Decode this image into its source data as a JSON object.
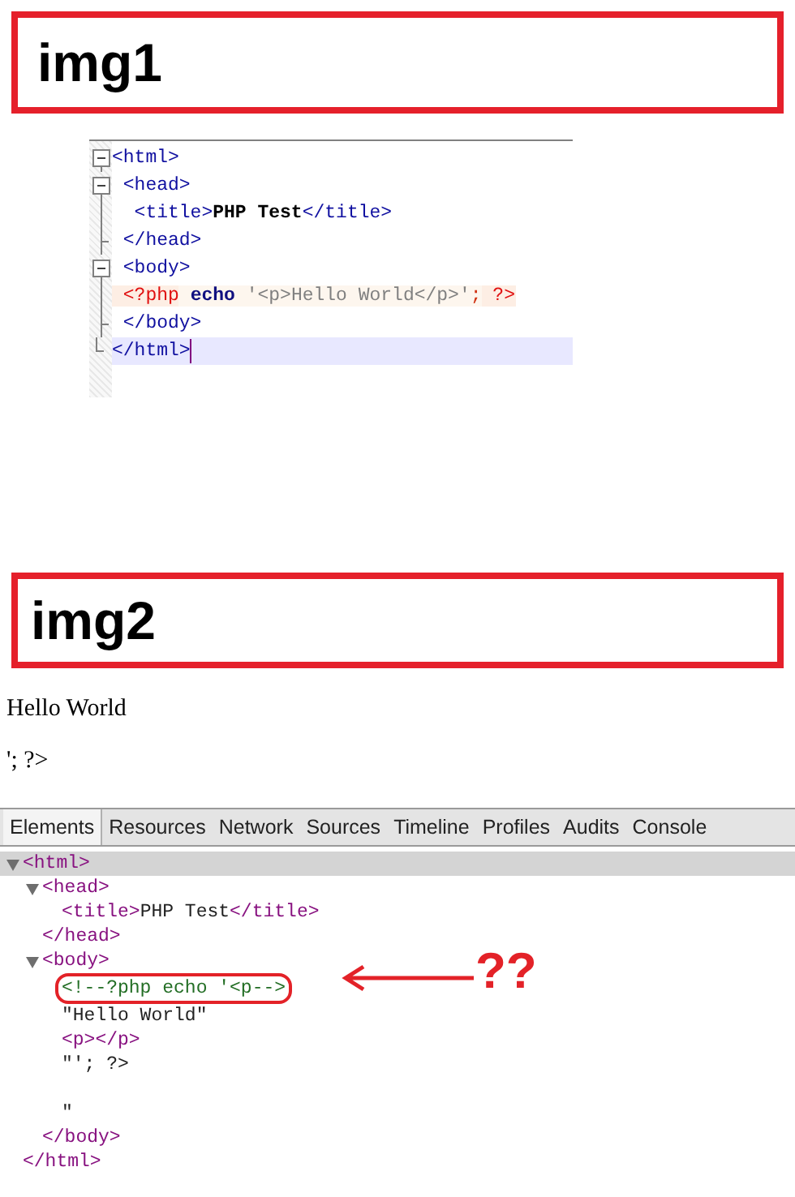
{
  "img1_label": "img1",
  "editor": {
    "lines": [
      {
        "kind": "open",
        "selected": false,
        "segments": [
          {
            "kind": "tag",
            "text": "<html>"
          }
        ]
      },
      {
        "kind": "open",
        "selected": false,
        "segments": [
          {
            "kind": "tag",
            "text": " <head>"
          }
        ]
      },
      {
        "kind": "line",
        "selected": false,
        "segments": [
          {
            "kind": "tag",
            "text": "  <title>"
          },
          {
            "kind": "text",
            "text": "PHP Test"
          },
          {
            "kind": "tag",
            "text": "</title>"
          }
        ]
      },
      {
        "kind": "branch",
        "selected": false,
        "segments": [
          {
            "kind": "tag",
            "text": " </head>"
          }
        ]
      },
      {
        "kind": "open",
        "selected": false,
        "segments": [
          {
            "kind": "tag",
            "text": " <body>"
          }
        ]
      },
      {
        "kind": "line",
        "selected": false,
        "segments": [
          {
            "kind": "php",
            "text": " <?php"
          },
          {
            "kind": "keyword",
            "text": " echo"
          },
          {
            "kind": "string",
            "text": " '<p>Hello World</p>'"
          },
          {
            "kind": "punct",
            "text": ";"
          },
          {
            "kind": "php",
            "text": " ?>"
          }
        ]
      },
      {
        "kind": "branch",
        "selected": false,
        "segments": [
          {
            "kind": "tag",
            "text": " </body>"
          }
        ]
      },
      {
        "kind": "end",
        "selected": true,
        "segments": [
          {
            "kind": "tag",
            "text": "</html>"
          }
        ]
      }
    ]
  },
  "img2_label": "img2",
  "rendered_page": [
    "Hello World",
    "'; ?>"
  ],
  "devtools": {
    "tabs": [
      {
        "label": "Elements",
        "selected": true
      },
      {
        "label": "Resources",
        "selected": false
      },
      {
        "label": "Network",
        "selected": false
      },
      {
        "label": "Sources",
        "selected": false
      },
      {
        "label": "Timeline",
        "selected": false
      },
      {
        "label": "Profiles",
        "selected": false
      },
      {
        "label": "Audits",
        "selected": false
      },
      {
        "label": "Console",
        "selected": false
      }
    ],
    "tree": [
      {
        "kind": "element",
        "open": "<html>",
        "close": "</html>",
        "expanded": true,
        "selected": true,
        "children": [
          {
            "kind": "element",
            "open": "<head>",
            "close": "</head>",
            "expanded": true,
            "selected": false,
            "children": [
              {
                "kind": "element",
                "open": "<title>",
                "text": "PHP Test",
                "close": "</title>",
                "selected": false
              }
            ]
          },
          {
            "kind": "element",
            "open": "<body>",
            "close": "</body>",
            "expanded": true,
            "selected": false,
            "children": [
              {
                "kind": "comment",
                "text": "<!--?php echo '<p-->",
                "circled": true,
                "selected": false
              },
              {
                "kind": "text",
                "text": "\"Hello World\"",
                "selected": false
              },
              {
                "kind": "element",
                "open": "<p>",
                "close": "</p>",
                "selected": false
              },
              {
                "kind": "text",
                "text": "\"'; ?>\n\n\"",
                "selected": false
              }
            ]
          }
        ]
      }
    ]
  },
  "annotation": {
    "text": "??"
  }
}
